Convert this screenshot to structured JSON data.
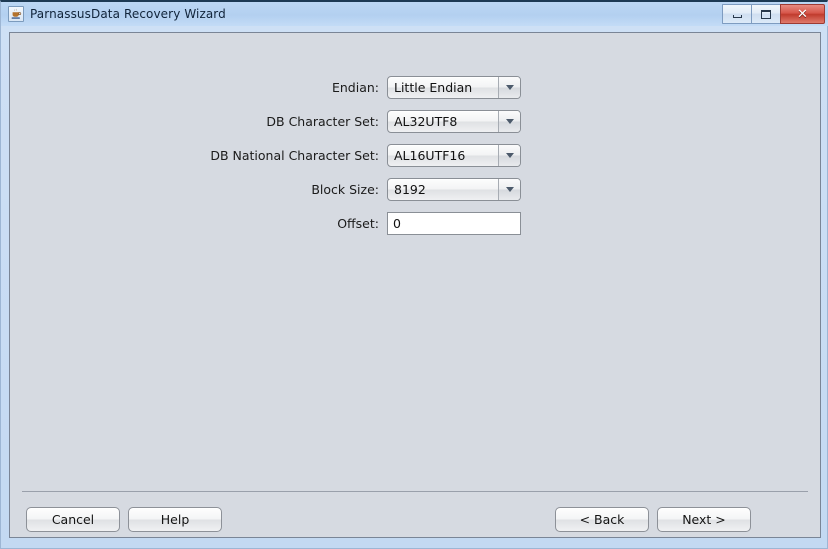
{
  "window": {
    "title": "ParnassusData Recovery Wizard",
    "icon": "java-coffee-cup-icon",
    "controls": {
      "minimize_label": "–",
      "maximize_label": "□",
      "close_label": "✕"
    },
    "colors": {
      "titlebar": "#b3d0f0",
      "frame": "#c3d9f2",
      "panel": "#d6dae1",
      "close_button": "#c03b2d"
    }
  },
  "form": {
    "rows": [
      {
        "label": "Endian:",
        "type": "combo",
        "value": "Little Endian",
        "name": "endian"
      },
      {
        "label": "DB Character Set:",
        "type": "combo",
        "value": "AL32UTF8",
        "name": "db-character-set"
      },
      {
        "label": "DB National Character Set:",
        "type": "combo",
        "value": "AL16UTF16",
        "name": "db-national-character-set"
      },
      {
        "label": "Block Size:",
        "type": "combo",
        "value": "8192",
        "name": "block-size"
      },
      {
        "label": "Offset:",
        "type": "text",
        "value": "0",
        "placeholder": "",
        "name": "offset"
      }
    ]
  },
  "buttons": {
    "cancel": "Cancel",
    "help": "Help",
    "back": "<  Back",
    "next": "Next  >"
  }
}
